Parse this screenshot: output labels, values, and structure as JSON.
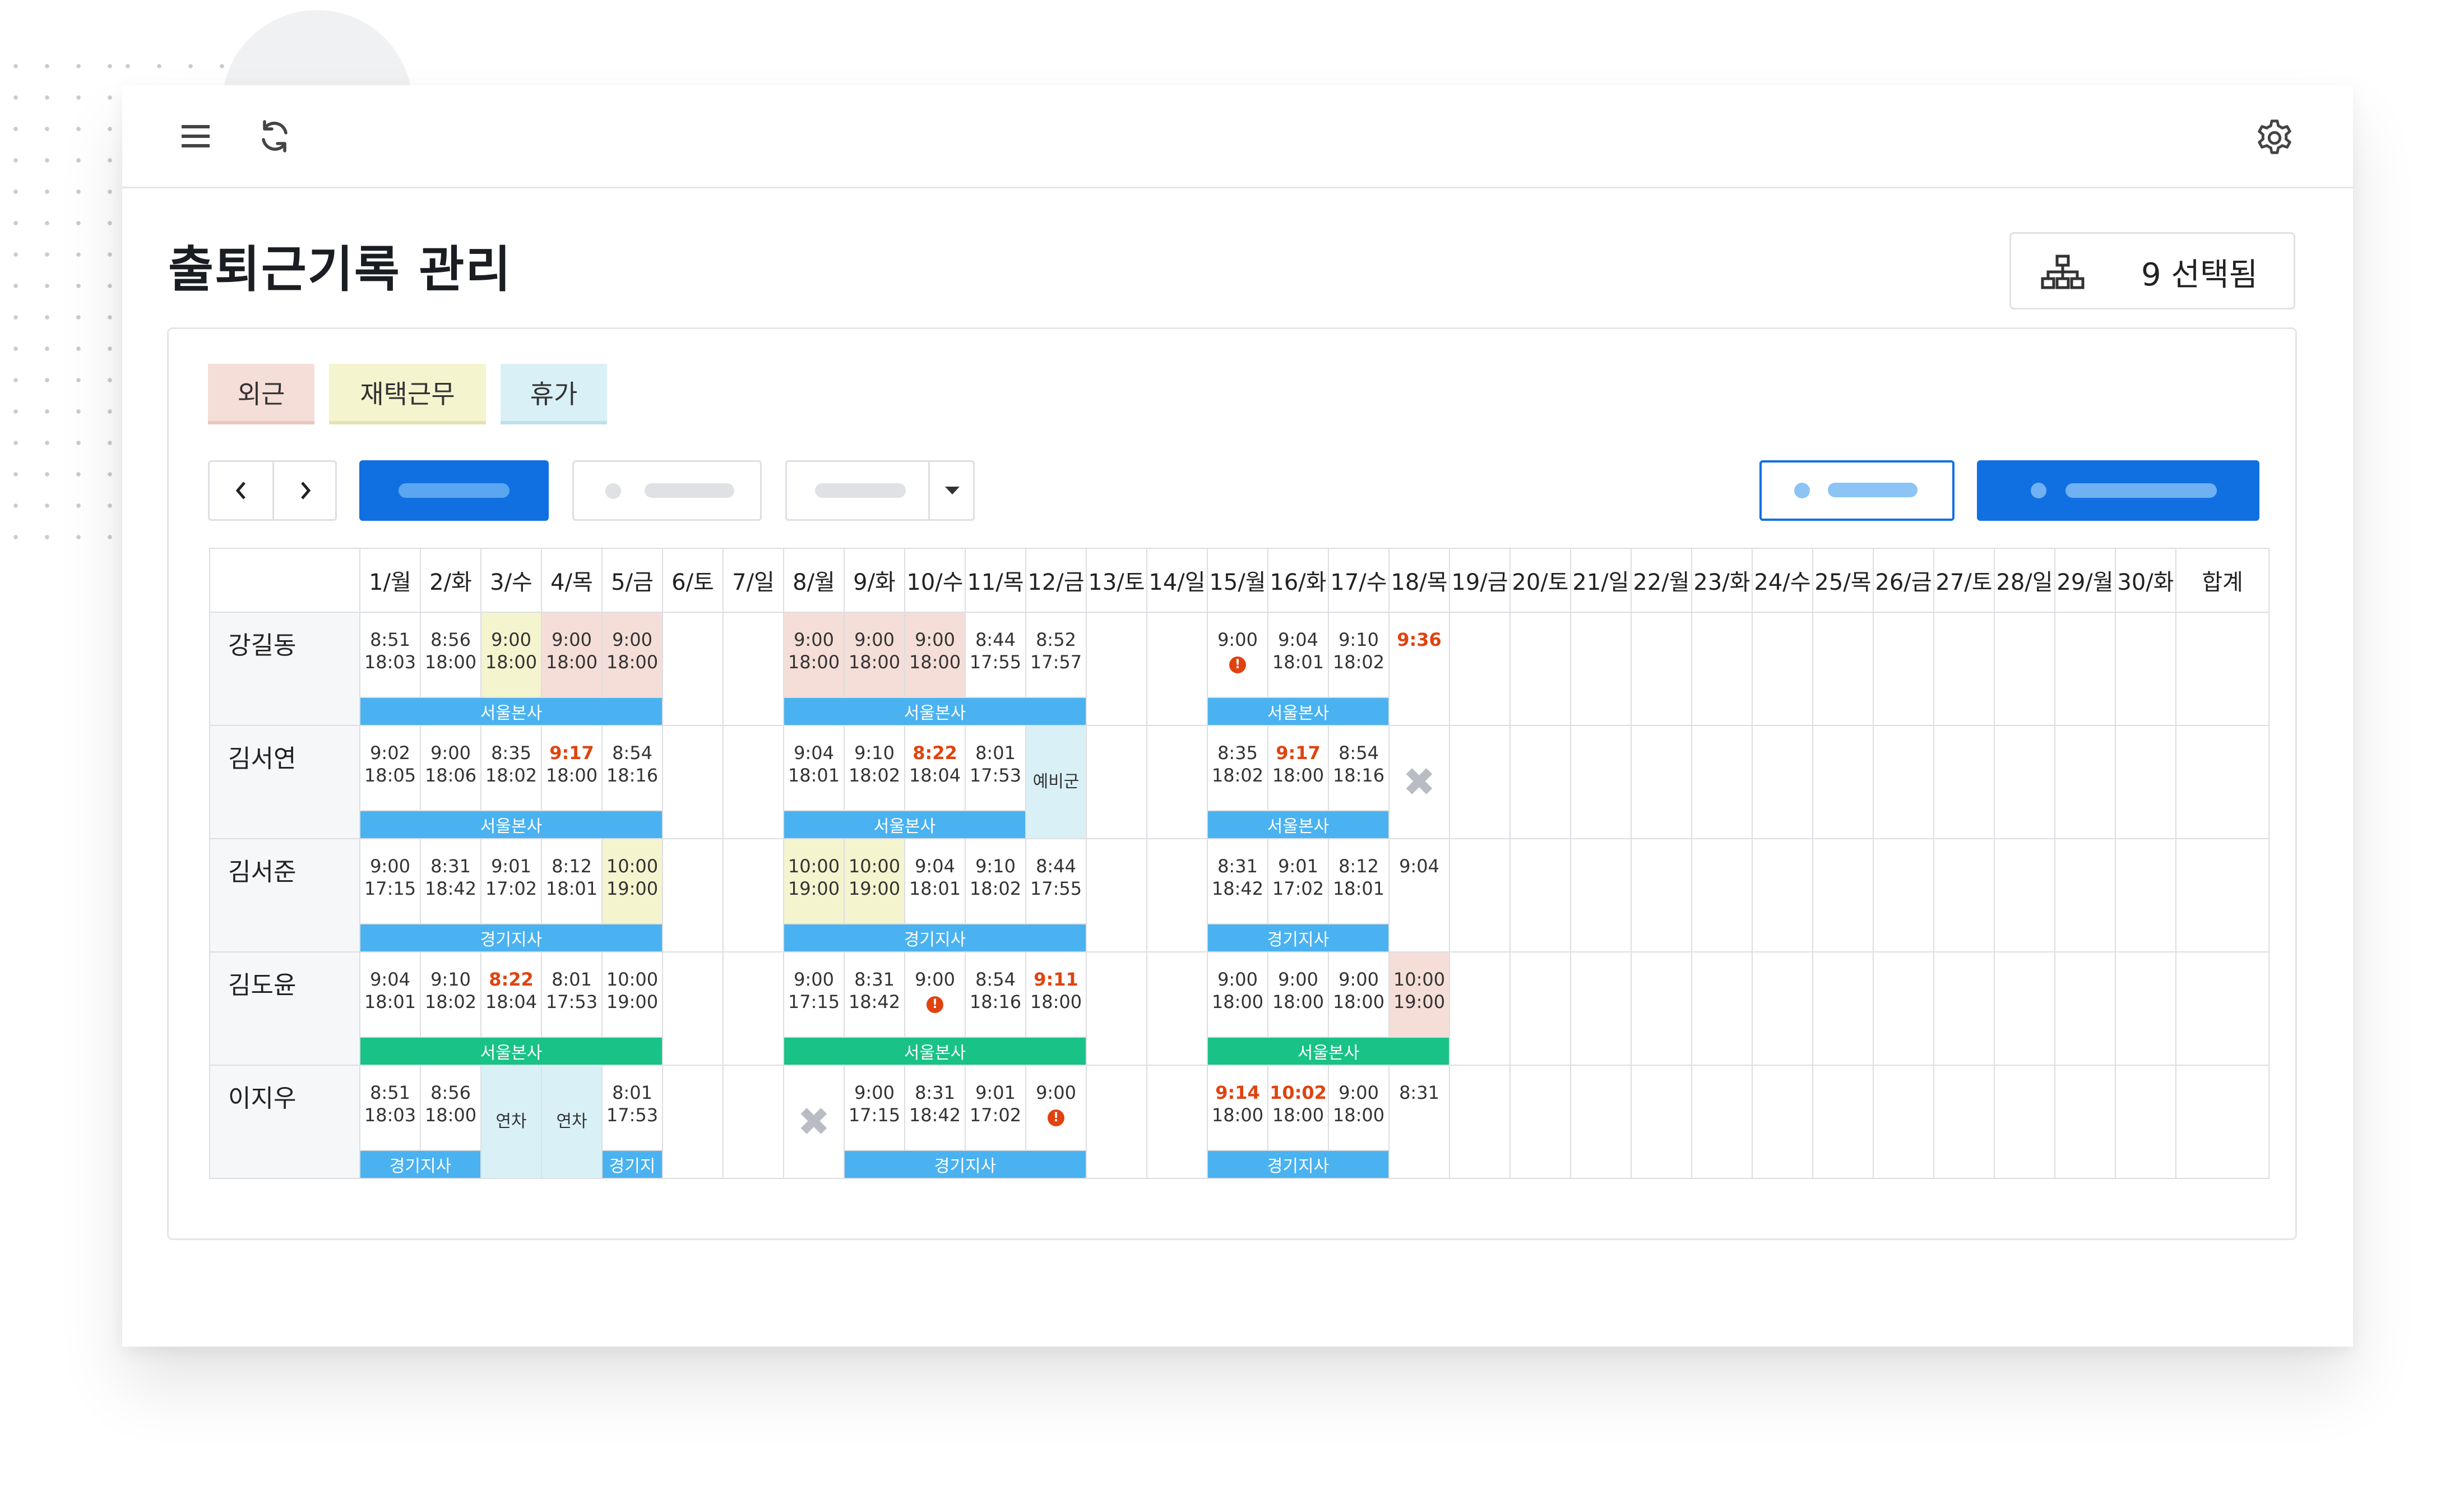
{
  "page": {
    "title": "출퇴근기록 관리",
    "selected_label": "9 선택됨"
  },
  "legend": [
    {
      "label": "외근",
      "bg": "#f5ded8",
      "line": "#e8c6bd"
    },
    {
      "label": "재택근무",
      "bg": "#f4f4cf",
      "line": "#e3e3ae"
    },
    {
      "label": "휴가",
      "bg": "#d9f1f6",
      "line": "#b9e2ec"
    }
  ],
  "colors": {
    "primary": "#1170e1",
    "band_blue": "#4ab2f0",
    "band_green": "#19c286",
    "late": "#e0430f",
    "remote": "#f4f4cf",
    "outside": "#f5ded8",
    "leave": "#d9f1f6"
  },
  "icons": {
    "menu": "hamburger-icon",
    "refresh": "refresh-icon",
    "settings": "gear-icon",
    "org": "org-chart-icon",
    "prev": "chevron-left-icon",
    "next": "chevron-right-icon",
    "dropdown": "caret-down-icon"
  },
  "days": [
    "1/월",
    "2/화",
    "3/수",
    "4/목",
    "5/금",
    "6/토",
    "7/일",
    "8/월",
    "9/화",
    "10/수",
    "11/목",
    "12/금",
    "13/토",
    "14/일",
    "15/월",
    "16/화",
    "17/수",
    "18/목",
    "19/금",
    "20/토",
    "21/일",
    "22/월",
    "23/화",
    "24/수",
    "25/목",
    "26/금",
    "27/토",
    "28/일",
    "29/월",
    "30/화"
  ],
  "total_label": "합계",
  "employees": [
    {
      "name": "강길동",
      "cells": [
        {
          "in": "8:51",
          "out": "18:03"
        },
        {
          "in": "8:56",
          "out": "18:00"
        },
        {
          "in": "9:00",
          "out": "18:00",
          "bg": "remote"
        },
        {
          "in": "9:00",
          "out": "18:00",
          "bg": "outside"
        },
        {
          "in": "9:00",
          "out": "18:00",
          "bg": "outside"
        },
        {},
        {},
        {
          "in": "9:00",
          "out": "18:00",
          "bg": "outside"
        },
        {
          "in": "9:00",
          "out": "18:00",
          "bg": "outside"
        },
        {
          "in": "9:00",
          "out": "18:00",
          "bg": "outside"
        },
        {
          "in": "8:44",
          "out": "17:55"
        },
        {
          "in": "8:52",
          "out": "17:57"
        },
        {},
        {},
        {
          "in": "9:00",
          "alert": true
        },
        {
          "in": "9:04",
          "out": "18:01"
        },
        {
          "in": "9:10",
          "out": "18:02"
        },
        {
          "in": "9:36",
          "late_in": true
        }
      ],
      "bands": [
        {
          "start": 0,
          "span": 5,
          "label": "서울본사",
          "color": "blue"
        },
        {
          "start": 7,
          "span": 5,
          "label": "서울본사",
          "color": "blue"
        },
        {
          "start": 14,
          "span": 3,
          "label": "서울본사",
          "color": "blue"
        }
      ]
    },
    {
      "name": "김서연",
      "cells": [
        {
          "in": "9:02",
          "out": "18:05"
        },
        {
          "in": "9:00",
          "out": "18:06"
        },
        {
          "in": "8:35",
          "out": "18:02"
        },
        {
          "in": "9:17",
          "out": "18:00",
          "late_in": true
        },
        {
          "in": "8:54",
          "out": "18:16"
        },
        {},
        {},
        {
          "in": "9:04",
          "out": "18:01"
        },
        {
          "in": "9:10",
          "out": "18:02"
        },
        {
          "in": "8:22",
          "out": "18:04",
          "late_in": true
        },
        {
          "in": "8:01",
          "out": "17:53"
        },
        {
          "leave": "예비군",
          "bg": "leave"
        },
        {},
        {},
        {
          "in": "8:35",
          "out": "18:02"
        },
        {
          "in": "9:17",
          "out": "18:00",
          "late_in": true
        },
        {
          "in": "8:54",
          "out": "18:16"
        },
        {
          "absent": true
        }
      ],
      "bands": [
        {
          "start": 0,
          "span": 5,
          "label": "서울본사",
          "color": "blue"
        },
        {
          "start": 7,
          "span": 4,
          "label": "서울본사",
          "color": "blue"
        },
        {
          "start": 14,
          "span": 3,
          "label": "서울본사",
          "color": "blue"
        }
      ]
    },
    {
      "name": "김서준",
      "cells": [
        {
          "in": "9:00",
          "out": "17:15"
        },
        {
          "in": "8:31",
          "out": "18:42"
        },
        {
          "in": "9:01",
          "out": "17:02"
        },
        {
          "in": "8:12",
          "out": "18:01"
        },
        {
          "in": "10:00",
          "out": "19:00",
          "bg": "remote"
        },
        {},
        {},
        {
          "in": "10:00",
          "out": "19:00",
          "bg": "remote"
        },
        {
          "in": "10:00",
          "out": "19:00",
          "bg": "remote"
        },
        {
          "in": "9:04",
          "out": "18:01"
        },
        {
          "in": "9:10",
          "out": "18:02"
        },
        {
          "in": "8:44",
          "out": "17:55"
        },
        {},
        {},
        {
          "in": "8:31",
          "out": "18:42"
        },
        {
          "in": "9:01",
          "out": "17:02"
        },
        {
          "in": "8:12",
          "out": "18:01"
        },
        {
          "in": "9:04"
        }
      ],
      "bands": [
        {
          "start": 0,
          "span": 5,
          "label": "경기지사",
          "color": "blue"
        },
        {
          "start": 7,
          "span": 5,
          "label": "경기지사",
          "color": "blue"
        },
        {
          "start": 14,
          "span": 3,
          "label": "경기지사",
          "color": "blue"
        }
      ]
    },
    {
      "name": "김도윤",
      "cells": [
        {
          "in": "9:04",
          "out": "18:01"
        },
        {
          "in": "9:10",
          "out": "18:02"
        },
        {
          "in": "8:22",
          "out": "18:04",
          "late_in": true
        },
        {
          "in": "8:01",
          "out": "17:53"
        },
        {
          "in": "10:00",
          "out": "19:00"
        },
        {},
        {},
        {
          "in": "9:00",
          "out": "17:15"
        },
        {
          "in": "8:31",
          "out": "18:42"
        },
        {
          "in": "9:00",
          "alert": true
        },
        {
          "in": "8:54",
          "out": "18:16"
        },
        {
          "in": "9:11",
          "out": "18:00",
          "late_in": true
        },
        {},
        {},
        {
          "in": "9:00",
          "out": "18:00"
        },
        {
          "in": "9:00",
          "out": "18:00"
        },
        {
          "in": "9:00",
          "out": "18:00"
        },
        {
          "in": "10:00",
          "out": "19:00",
          "bg": "outside"
        }
      ],
      "bands": [
        {
          "start": 0,
          "span": 5,
          "label": "서울본사",
          "color": "green"
        },
        {
          "start": 7,
          "span": 5,
          "label": "서울본사",
          "color": "green"
        },
        {
          "start": 14,
          "span": 4,
          "label": "서울본사",
          "color": "green"
        }
      ]
    },
    {
      "name": "이지우",
      "cells": [
        {
          "in": "8:51",
          "out": "18:03"
        },
        {
          "in": "8:56",
          "out": "18:00"
        },
        {
          "leave": "연차",
          "bg": "leave",
          "full": true
        },
        {
          "leave": "연차",
          "bg": "leave",
          "full": true
        },
        {
          "in": "8:01",
          "out": "17:53"
        },
        {},
        {},
        {
          "absent": true
        },
        {
          "in": "9:00",
          "out": "17:15"
        },
        {
          "in": "8:31",
          "out": "18:42"
        },
        {
          "in": "9:01",
          "out": "17:02"
        },
        {
          "in": "9:00",
          "alert": true
        },
        {},
        {},
        {
          "in": "9:14",
          "out": "18:00",
          "late_in": true
        },
        {
          "in": "10:02",
          "out": "18:00",
          "late_in": true
        },
        {
          "in": "9:00",
          "out": "18:00"
        },
        {
          "in": "8:31"
        }
      ],
      "bands": [
        {
          "start": 0,
          "span": 2,
          "label": "경기지사",
          "color": "blue"
        },
        {
          "start": 4,
          "span": 1,
          "label": "경기지",
          "color": "blue"
        },
        {
          "start": 8,
          "span": 4,
          "label": "경기지사",
          "color": "blue"
        },
        {
          "start": 14,
          "span": 3,
          "label": "경기지사",
          "color": "blue"
        }
      ]
    }
  ]
}
